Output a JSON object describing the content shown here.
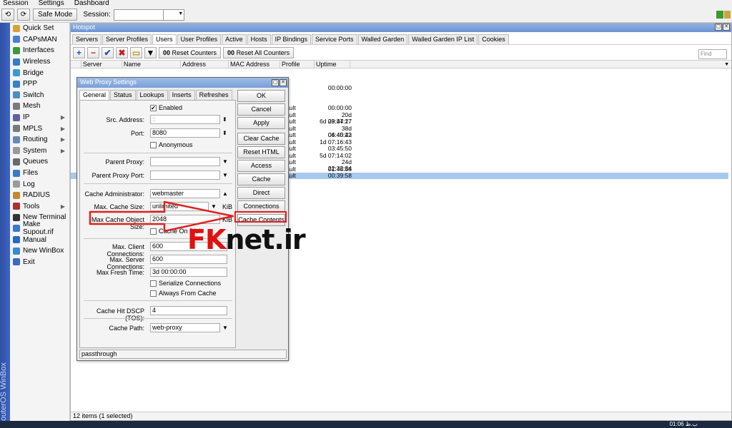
{
  "menu": [
    "Session",
    "Settings",
    "Dashboard"
  ],
  "toolbar": {
    "undo_label": "⟲",
    "redo_label": "⟳",
    "safe_mode_label": "Safe Mode",
    "session_label": "Session:",
    "session_value": ""
  },
  "side_strip_label": "RouterOS WinBox",
  "sidebar": [
    {
      "label": "Quick Set",
      "color": "#d9a13a",
      "arrow": false
    },
    {
      "label": "CAPsMAN",
      "color": "#4a7fd0",
      "arrow": false
    },
    {
      "label": "Interfaces",
      "color": "#3c9a3c",
      "arrow": false
    },
    {
      "label": "Wireless",
      "color": "#3a7ac8",
      "arrow": false
    },
    {
      "label": "Bridge",
      "color": "#3a9ad0",
      "arrow": false
    },
    {
      "label": "PPP",
      "color": "#3a80c8",
      "arrow": false
    },
    {
      "label": "Switch",
      "color": "#4a90c0",
      "arrow": false
    },
    {
      "label": "Mesh",
      "color": "#7a7a7a",
      "arrow": false
    },
    {
      "label": "IP",
      "color": "#6060a0",
      "arrow": true
    },
    {
      "label": "MPLS",
      "color": "#7a7a7a",
      "arrow": true
    },
    {
      "label": "Routing",
      "color": "#6a8ab0",
      "arrow": true
    },
    {
      "label": "System",
      "color": "#9a9a9a",
      "arrow": true
    },
    {
      "label": "Queues",
      "color": "#6a6a6a",
      "arrow": false
    },
    {
      "label": "Files",
      "color": "#3a7ac8",
      "arrow": false
    },
    {
      "label": "Log",
      "color": "#9a9a9a",
      "arrow": false
    },
    {
      "label": "RADIUS",
      "color": "#c08a30",
      "arrow": false
    },
    {
      "label": "Tools",
      "color": "#b03030",
      "arrow": true
    },
    {
      "label": "New Terminal",
      "color": "#333333",
      "arrow": false
    },
    {
      "label": "Make Supout.rif",
      "color": "#3a7ac8",
      "arrow": false
    },
    {
      "label": "Manual",
      "color": "#2a6ac0",
      "arrow": false
    },
    {
      "label": "New WinBox",
      "color": "#3a8ad0",
      "arrow": false
    },
    {
      "label": "Exit",
      "color": "#3a6ac0",
      "arrow": false
    }
  ],
  "main": {
    "title": "Hotspot",
    "tabs": [
      "Servers",
      "Server Profiles",
      "Users",
      "User Profiles",
      "Active",
      "Hosts",
      "IP Bindings",
      "Service Ports",
      "Walled Garden",
      "Walled Garden IP List",
      "Cookies"
    ],
    "active_tab": 2,
    "reset_counters": "Reset Counters",
    "reset_all_counters": "Reset All Counters",
    "find_placeholder": "Find",
    "columns": [
      "Server",
      "Name",
      "Address",
      "MAC Address",
      "Profile",
      "Uptime"
    ],
    "rows": [
      {
        "profile": "",
        "uptime": "00:00:00"
      },
      {
        "profile": "ault",
        "uptime": "00:00:00"
      },
      {
        "profile": "ault",
        "uptime": "20d 09:34:27"
      },
      {
        "profile": "ault",
        "uptime": "6d 23:47:17"
      },
      {
        "profile": "ault",
        "uptime": "38d 06:40:42"
      },
      {
        "profile": "ault",
        "uptime": "04:45:23"
      },
      {
        "profile": "ault",
        "uptime": "1d 07:16:43"
      },
      {
        "profile": "ault",
        "uptime": "03:45:50"
      },
      {
        "profile": "ault",
        "uptime": "5d 07:14:02"
      },
      {
        "profile": "ault",
        "uptime": "24d 22:32:34"
      },
      {
        "profile": "ault",
        "uptime": "01:46:58"
      },
      {
        "profile": "ault",
        "uptime": "00:39:58"
      }
    ],
    "selected_row": 11,
    "status": "12 items (1 selected)"
  },
  "dialog": {
    "title": "Web Proxy Settings",
    "tabs": [
      "General",
      "Status",
      "Lookups",
      "Inserts",
      "Refreshes"
    ],
    "enabled_label": "Enabled",
    "src_address_label": "Src. Address:",
    "src_address_value": "::",
    "port_label": "Port:",
    "port_value": "8080",
    "anonymous_label": "Anonymous",
    "parent_proxy_label": "Parent Proxy:",
    "parent_proxy_port_label": "Parent Proxy Port:",
    "cache_admin_label": "Cache Administrator:",
    "cache_admin_value": "webmaster",
    "max_cache_size_label": "Max. Cache Size:",
    "max_cache_size_value": "unlimited",
    "max_cache_size_unit": "KiB",
    "max_cache_obj_label": "Max Cache Object Size:",
    "max_cache_obj_value": "2048",
    "max_cache_obj_unit": "KiB",
    "cache_on_disk_label": "Cache On Disk",
    "max_client_conn_label": "Max. Client Connections:",
    "max_client_conn_value": "600",
    "max_server_conn_label": "Max. Server Connections:",
    "max_server_conn_value": "600",
    "max_fresh_time_label": "Max Fresh Time:",
    "max_fresh_time_value": "3d 00:00:00",
    "serialize_label": "Serialize Connections",
    "always_from_cache_label": "Always From Cache",
    "dscp_label": "Cache Hit DSCP (TOS):",
    "dscp_value": "4",
    "cache_path_label": "Cache Path:",
    "cache_path_value": "web-proxy",
    "buttons": [
      "OK",
      "Cancel",
      "Apply",
      "Clear Cache",
      "Reset HTML",
      "Access",
      "Cache",
      "Direct",
      "Connections",
      "Cache Contents"
    ],
    "status": "passthrough"
  },
  "watermark": {
    "part1": "FK",
    "part2": "net.ir"
  },
  "taskbar": {
    "clock": "01:06 ب.ظ"
  },
  "colors": {
    "highlight": "#e02020",
    "selected_row": "#a9c8ee",
    "title_bar": "#7aa0d9"
  }
}
